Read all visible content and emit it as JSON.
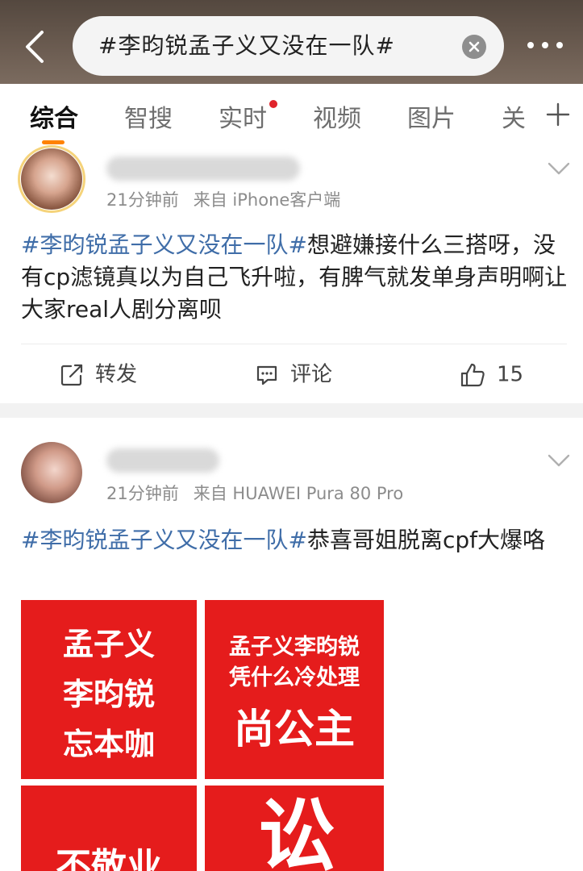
{
  "search": {
    "query": "#李昀锐孟子义又没在一队#"
  },
  "tabs": [
    {
      "label": "综合",
      "active": true
    },
    {
      "label": "智搜",
      "active": false
    },
    {
      "label": "实时",
      "active": false,
      "has_dot": true
    },
    {
      "label": "视频",
      "active": false
    },
    {
      "label": "图片",
      "active": false
    },
    {
      "label": "关",
      "active": false
    }
  ],
  "posts": [
    {
      "time": "21分钟前",
      "source": "来自 iPhone客户端",
      "hashtag": "#李昀锐孟子义又没在一队#",
      "text": "想避嫌接什么三搭呀，没有cp滤镜真以为自己飞升啦，有脾气就发单身声明啊让大家real人剧分离呗",
      "actions": {
        "repost": "转发",
        "comment": "评论",
        "like_count": "15"
      }
    },
    {
      "time": "21分钟前",
      "source": "来自 HUAWEI Pura 80 Pro",
      "hashtag": "#李昀锐孟子义又没在一队#",
      "text": "恭喜哥姐脱离cpf大爆咯",
      "images": [
        {
          "lines": [
            "孟子义",
            "李昀锐",
            "忘本咖"
          ]
        },
        {
          "lines": [
            "孟子义李昀锐",
            "凭什么冷处理",
            "尚公主"
          ]
        },
        {
          "lines": [
            "不敬业"
          ]
        },
        {
          "lines": [
            "讼"
          ]
        }
      ]
    }
  ],
  "colors": {
    "accent": "#ff8200",
    "hashtag": "#3f6da8",
    "dot": "#e0242b",
    "image_bg": "#e51c1c"
  },
  "icons": {
    "back": "chevron-left-icon",
    "clear": "close-circle-icon",
    "more": "more-dots-icon",
    "add_tab": "plus-icon",
    "repost": "repost-icon",
    "comment": "comment-icon",
    "like": "thumbs-up-icon"
  }
}
